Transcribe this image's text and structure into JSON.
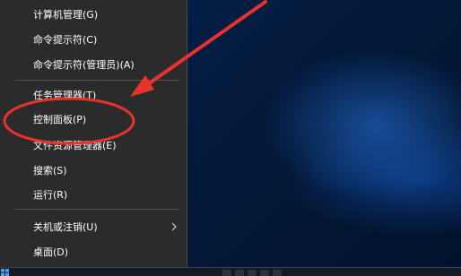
{
  "menu": {
    "items": [
      {
        "label": "计算机管理(G)"
      },
      {
        "label": "命令提示符(C)"
      },
      {
        "label": "命令提示符(管理员)(A)"
      },
      {
        "label": "任务管理器(T)"
      },
      {
        "label": "控制面板(P)"
      },
      {
        "label": "文件资源管理器(E)"
      },
      {
        "label": "搜索(S)"
      },
      {
        "label": "运行(R)"
      },
      {
        "label": "关机或注销(U)"
      },
      {
        "label": "桌面(D)"
      }
    ]
  },
  "annotation": {
    "color": "#e8322b",
    "target": "控制面板(P)"
  },
  "colors": {
    "menu_bg": "#2b2b2b",
    "menu_text": "#ffffff",
    "separator": "#555555",
    "desktop_accent": "#1e6fd9"
  },
  "icons": [
    "chevron-right-icon",
    "windows-start-icon"
  ]
}
